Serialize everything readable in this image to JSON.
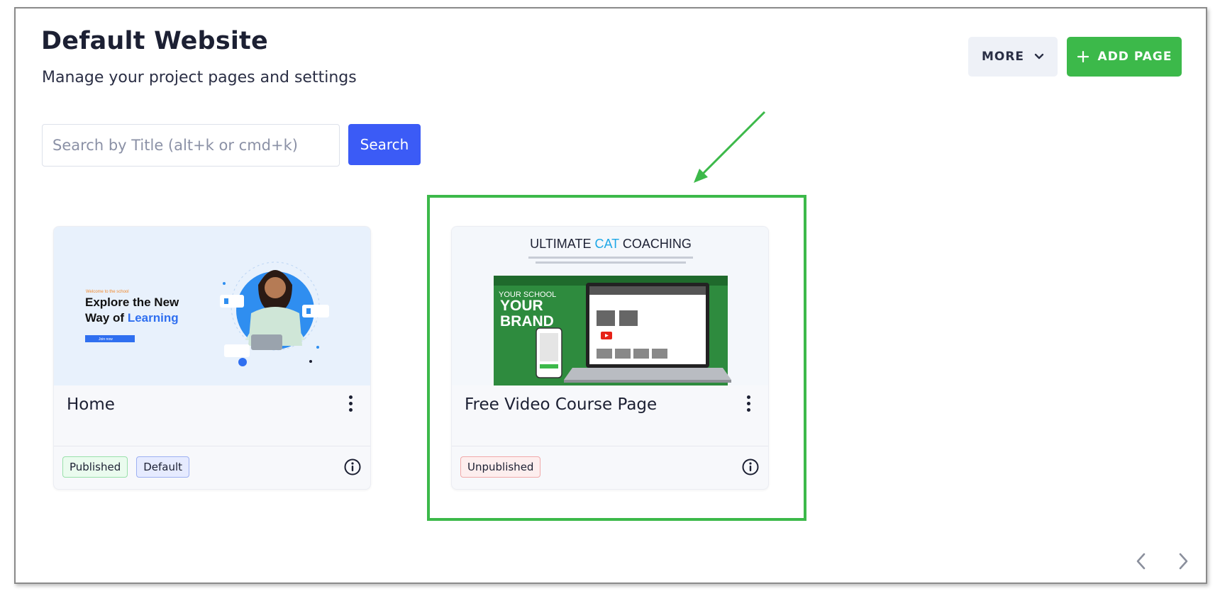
{
  "header": {
    "title": "Default Website",
    "subtitle": "Manage your project pages and settings",
    "more_label": "MORE",
    "add_page_label": "ADD PAGE"
  },
  "search": {
    "placeholder": "Search by Title (alt+k or cmd+k)",
    "value": "",
    "button_label": "Search"
  },
  "cards": [
    {
      "title": "Home",
      "badges": [
        "Published",
        "Default"
      ],
      "thumbnail": {
        "eyebrow": "Welcome to the school",
        "headline_line1": "Explore the New",
        "headline_line2_prefix": "Way of ",
        "headline_line2_accent": "Learning",
        "cta": "Join now"
      }
    },
    {
      "title": "Free Video Course Page",
      "badges": [
        "Unpublished"
      ],
      "thumbnail": {
        "heading_prefix": "ULTIMATE ",
        "heading_accent": "CAT",
        "heading_suffix": " COACHING",
        "video_text_line1": "YOUR SCHOOL",
        "video_text_line2": "YOUR",
        "video_text_line3": "BRAND"
      }
    }
  ],
  "icons": {
    "more": "chevron-down-icon",
    "add": "plus-icon",
    "card_menu": "kebab-menu-icon",
    "info": "info-circle-icon",
    "prev": "chevron-left-icon",
    "next": "chevron-right-icon",
    "annotation": "arrow-annotation"
  },
  "colors": {
    "primary_blue": "#3b5bf6",
    "success_green": "#3cb94a",
    "highlight_green": "#3cb94a",
    "text_dark": "#1c2033"
  }
}
